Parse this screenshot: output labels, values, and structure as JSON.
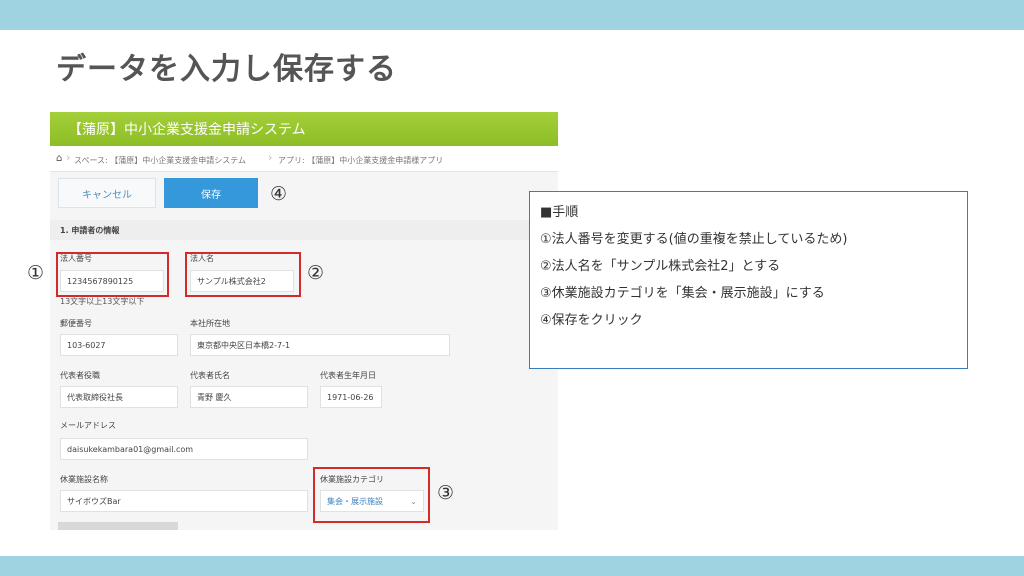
{
  "slide": {
    "title": "データを入力し保存する"
  },
  "app": {
    "header_title": "【蒲原】中小企業支援金申請システム",
    "breadcrumb": {
      "space": "スペース: 【蒲原】中小企業支援金申請システム",
      "app": "アプリ: 【蒲原】中小企業支援金申請様アプリ"
    },
    "buttons": {
      "cancel": "キャンセル",
      "save": "保存"
    },
    "section_title": "1. 申請者の情報",
    "fields": {
      "corp_number_label": "法人番号",
      "corp_number_value": "1234567890125",
      "corp_number_hint": "13文字以上13文字以下",
      "corp_name_label": "法人名",
      "corp_name_value": "サンプル株式会社2",
      "postal_label": "郵便番号",
      "postal_value": "103-6027",
      "address_label": "本社所在地",
      "address_value": "東京都中央区日本橋2-7-1",
      "rep_title_label": "代表者役職",
      "rep_title_value": "代表取締役社長",
      "rep_name_label": "代表者氏名",
      "rep_name_value": "青野 慶久",
      "rep_birth_label": "代表者生年月日",
      "rep_birth_value": "1971-06-26",
      "email_label": "メールアドレス",
      "email_value": "daisukekambara01@gmail.com",
      "facility_name_label": "休業施設名称",
      "facility_name_value": "サイボウズBar",
      "facility_cat_label": "休業施設カテゴリ",
      "facility_cat_value": "集会・展示施設"
    }
  },
  "markers": {
    "m1": "①",
    "m2": "②",
    "m3": "③",
    "m4": "④"
  },
  "steps": {
    "heading": "■手順",
    "items": [
      "①法人番号を変更する(値の重複を禁止しているため)",
      "②法人名を「サンプル株式会社2」とする",
      "③休業施設カテゴリを「集会・展示施設」にする",
      "④保存をクリック"
    ]
  },
  "colors": {
    "band": "#9fd3e2",
    "header_green": "#8dbd24",
    "save_blue": "#3498db",
    "highlight_red": "#d42a2a",
    "box_border": "#3a7cc0"
  }
}
